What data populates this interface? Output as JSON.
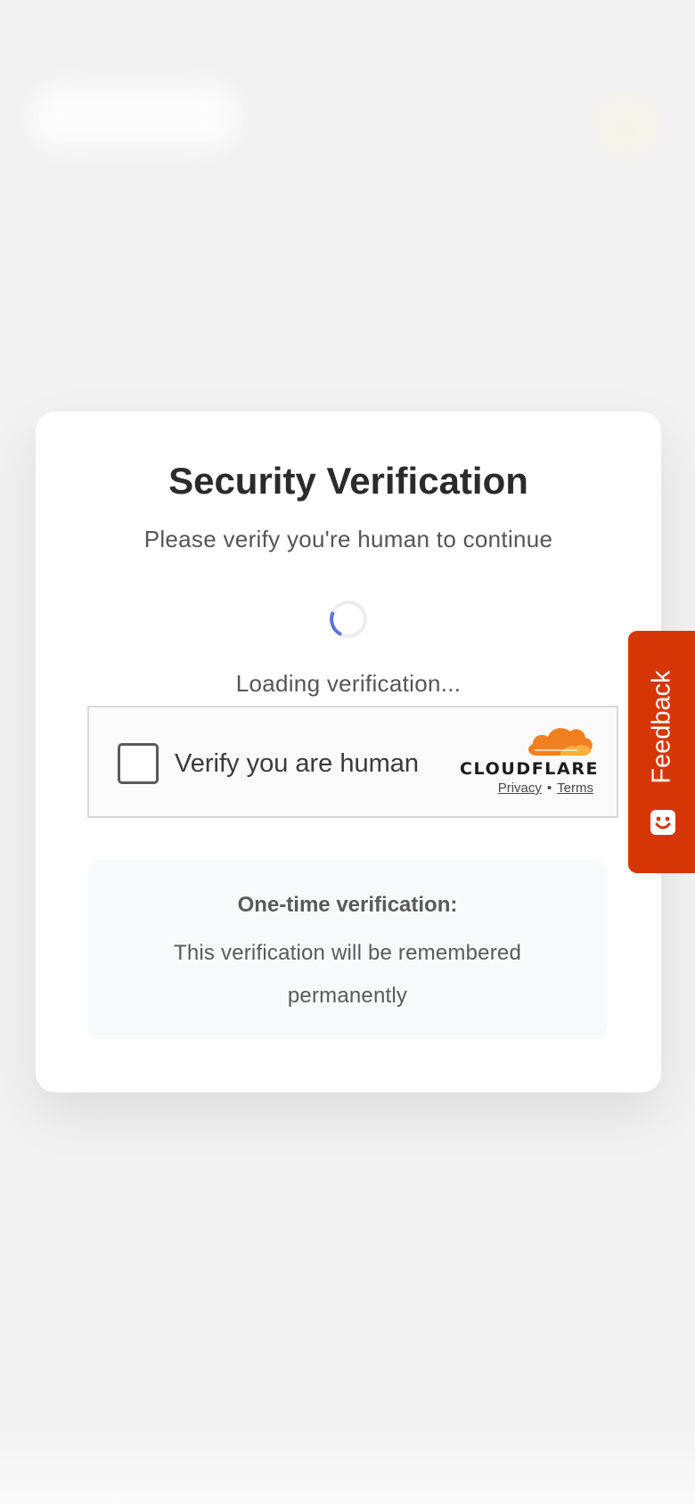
{
  "verification": {
    "title": "Security Verification",
    "subtitle": "Please verify you're human to continue",
    "loading_text": "Loading verification..."
  },
  "turnstile": {
    "checkbox_label": "Verify you are human",
    "brand": "CLOUDFLARE",
    "privacy_label": "Privacy",
    "separator": "•",
    "terms_label": "Terms"
  },
  "info": {
    "title": "One-time verification:",
    "text": "This verification will be remembered permanently"
  },
  "feedback": {
    "label": "Feedback",
    "icon": "smiley-chat-icon"
  },
  "colors": {
    "page_background": "#f2f2f3",
    "card_background": "#ffffff",
    "spinner_accent": "#5b73d8",
    "cloudflare_orange": "#f38020",
    "feedback_background": "#d63606"
  },
  "icons": [
    "loading-spinner-icon",
    "cloudflare-cloud-icon",
    "smiley-chat-icon"
  ]
}
